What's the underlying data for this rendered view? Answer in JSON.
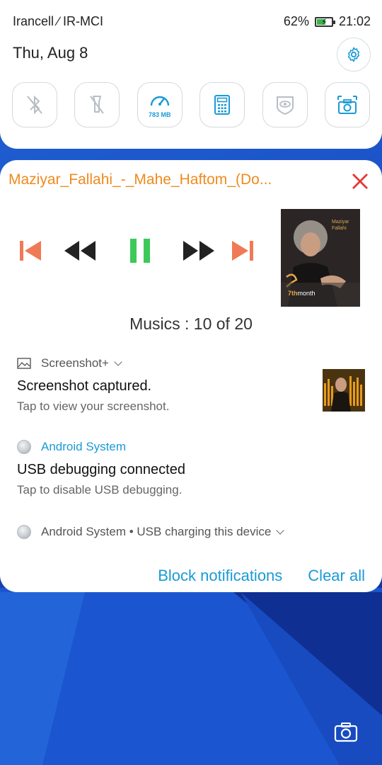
{
  "status_bar": {
    "carrier": "Irancell ∕ IR-MCI",
    "battery": "62%",
    "battery_level": 0.62,
    "time": "21:02"
  },
  "quick_settings": {
    "date": "Thu, Aug 8",
    "tiles": [
      {
        "icon": "bluetooth-off-icon"
      },
      {
        "icon": "flashlight-off-icon"
      },
      {
        "icon": "memory-boost-icon",
        "label": "783 MB"
      },
      {
        "icon": "calculator-icon"
      },
      {
        "icon": "eye-care-icon"
      },
      {
        "icon": "screenshot-icon"
      }
    ]
  },
  "now_playing": {
    "title": "Maziyar_Fallahi_-_Mahe_Haftom_(Do...",
    "album_art_text": "7thmonth",
    "album_art_artist": "Maziyar Fallahi",
    "count_text": "Musics : 10 of 20",
    "colors": {
      "title": "#f08a1d",
      "skip": "#f07a55",
      "seek": "#222222",
      "play": "#3cc95a",
      "close": "#e53935"
    }
  },
  "notifications": [
    {
      "app": "Screenshot+",
      "title": "Screenshot captured.",
      "text": "Tap to view your screenshot."
    },
    {
      "app": "Android System",
      "title": "USB debugging connected",
      "text": "Tap to disable USB debugging."
    },
    {
      "app": "Android System • USB charging this device"
    }
  ],
  "actions": {
    "block": "Block notifications",
    "clear": "Clear all"
  },
  "accent": "#1a9ad6"
}
